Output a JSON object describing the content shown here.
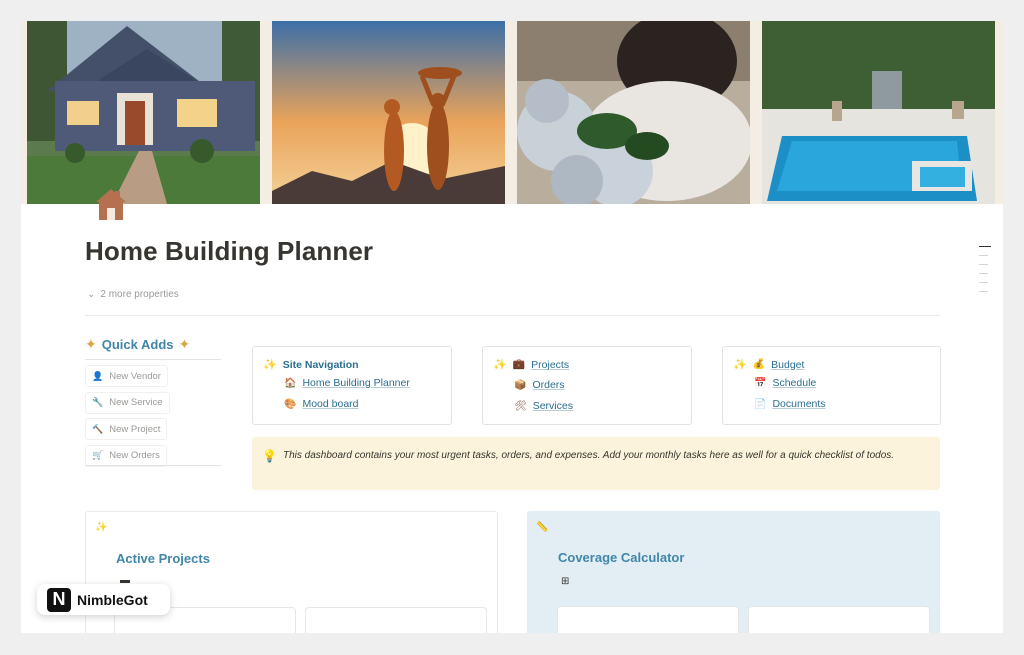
{
  "page": {
    "title": "Home Building Planner",
    "more_properties": "2 more properties",
    "icon": "house-icon"
  },
  "banner": {
    "images": [
      "house-exterior-photo",
      "family-silhouette-photo",
      "woman-with-hydrangeas-photo",
      "backyard-pool-photo"
    ]
  },
  "quick_adds": {
    "title": "Quick Adds",
    "buttons": [
      {
        "label": "New Vendor",
        "icon": "person-add-icon"
      },
      {
        "label": "New Service",
        "icon": "wrench-icon"
      },
      {
        "label": "New Project",
        "icon": "hammer-icon"
      },
      {
        "label": "New Orders",
        "icon": "cart-icon"
      }
    ]
  },
  "nav_cards": [
    {
      "header": "Site Navigation",
      "links": [
        "Home Building Planner",
        "Mood board"
      ]
    },
    {
      "links": [
        "Projects",
        "Orders",
        "Services"
      ]
    },
    {
      "links": [
        "Budget",
        "Schedule",
        "Documents"
      ]
    }
  ],
  "callout": {
    "text": "This dashboard contains your most urgent tasks, orders, and expenses. Add your monthly tasks here as well for a quick checklist of todos."
  },
  "active_projects": {
    "title": "Active Projects"
  },
  "coverage_calculator": {
    "title": "Coverage Calculator"
  },
  "brand": {
    "logo_letter": "N",
    "name": "NimbleGot"
  },
  "colors": {
    "accent_blue": "#3f86a8",
    "link_blue": "#2b6e8f",
    "callout_bg": "#fbf3db",
    "panel_bg": "#e3eef4",
    "house_icon": "#b5714f"
  }
}
